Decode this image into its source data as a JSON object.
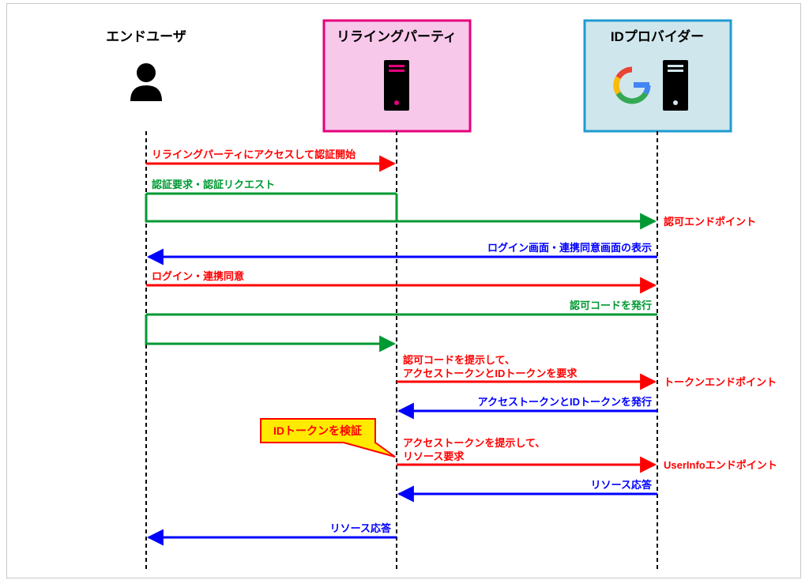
{
  "participants": {
    "end_user": {
      "label": "エンドユーザ"
    },
    "relying_party": {
      "label": "リライングパーティ"
    },
    "id_provider": {
      "label": "IDプロバイダー"
    }
  },
  "messages": {
    "m1": "リライングパーティにアクセスして認証開始",
    "m2": "認証要求・認証リクエスト",
    "m3": "認可エンドポイント",
    "m4": "ログイン画面・連携同意画面の表示",
    "m5": "ログイン・連携同意",
    "m6": "認可コードを発行",
    "m7a": "認可コードを提示して、",
    "m7b": "アクセストークンとIDトークンを要求",
    "m8": "トークンエンドポイント",
    "m9": "アクセストークンとIDトークンを発行",
    "m10": "IDトークンを検証",
    "m11a": "アクセストークンを提示して、",
    "m11b": "リソース要求",
    "m12": "UserInfoエンドポイント",
    "m13": "リソース応答",
    "m14": "リソース応答"
  },
  "chart_data": {
    "type": "sequence-diagram",
    "participants": [
      "エンドユーザ",
      "リライングパーティ",
      "IDプロバイダー"
    ],
    "steps": [
      {
        "from": "エンドユーザ",
        "to": "リライングパーティ",
        "label": "リライングパーティにアクセスして認証開始",
        "color": "red"
      },
      {
        "from": "エンドユーザ",
        "to": "IDプロバイダー",
        "via": "リライングパーティ",
        "label": "認証要求・認証リクエスト",
        "color": "green",
        "endpoint": "認可エンドポイント"
      },
      {
        "from": "IDプロバイダー",
        "to": "エンドユーザ",
        "label": "ログイン画面・連携同意画面の表示",
        "color": "blue"
      },
      {
        "from": "エンドユーザ",
        "to": "IDプロバイダー",
        "label": "ログイン・連携同意",
        "color": "red"
      },
      {
        "from": "IDプロバイダー",
        "to": "エンドユーザ",
        "via": "リライングパーティ",
        "label": "認可コードを発行",
        "color": "green"
      },
      {
        "from": "リライングパーティ",
        "to": "IDプロバイダー",
        "label": "認可コードを提示して、アクセストークンとIDトークンを要求",
        "color": "red",
        "endpoint": "トークンエンドポイント"
      },
      {
        "from": "IDプロバイダー",
        "to": "リライングパーティ",
        "label": "アクセストークンとIDトークンを発行",
        "color": "blue"
      },
      {
        "self": "リライングパーティ",
        "label": "IDトークンを検証",
        "callout": true
      },
      {
        "from": "リライングパーティ",
        "to": "IDプロバイダー",
        "label": "アクセストークンを提示して、リソース要求",
        "color": "red",
        "endpoint": "UserInfoエンドポイント"
      },
      {
        "from": "IDプロバイダー",
        "to": "リライングパーティ",
        "label": "リソース応答",
        "color": "blue"
      },
      {
        "from": "リライングパーティ",
        "to": "エンドユーザ",
        "label": "リソース応答",
        "color": "blue"
      }
    ]
  }
}
